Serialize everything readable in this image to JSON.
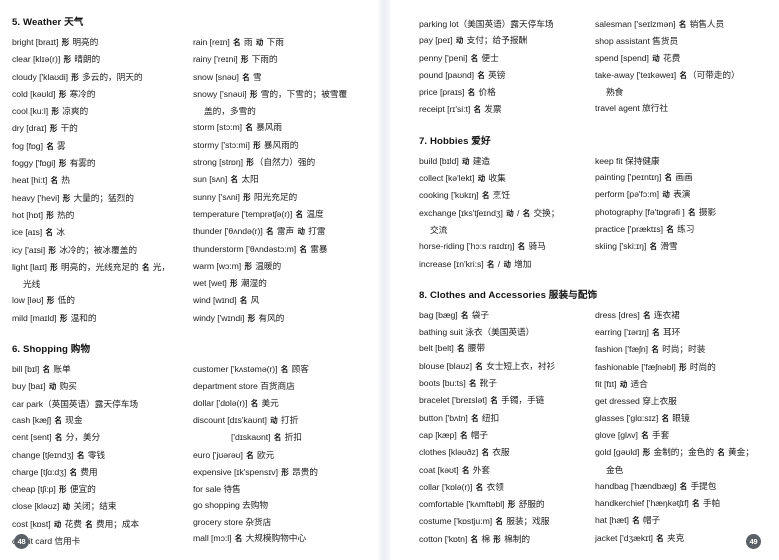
{
  "left_page": {
    "page_number": "48",
    "sections": [
      {
        "title": "5. Weather 天气",
        "column_a": [
          "bright [braɪt] 形 明亮的",
          "clear [klɪə(r)] 形 晴朗的",
          "cloudy ['klaʊdi] 形 多云的，阴天的",
          "cold [kəʊld] 形 寒冷的",
          "cool [ku:l] 形 凉爽的",
          "dry [draɪ] 形 干的",
          "fog [fɒg] 名 雾",
          "foggy ['fɒgi] 形 有雾的",
          "heat [hi:t] 名 热",
          "heavy ['hevi] 形 大量的；猛烈的",
          "hot [hɒt] 形 热的",
          "ice [aɪs] 名 冰",
          "icy ['aɪsi] 形 冰冷的；被冰覆盖的",
          "light [laɪt] 形 明亮的，光线充足的 名 光，",
          "光线",
          "low [ləʊ] 形 低的",
          "mild [maɪld] 形 温和的"
        ],
        "column_b": [
          "rain [reɪn] 名 雨 动 下雨",
          "rainy ['reɪni] 形 下雨的",
          "snow [snəʊ] 名 雪",
          "snowy ['snəʊi] 形 雪的，下雪的；被雪覆",
          "盖的，多雪的",
          "storm [stɔ:m] 名 暴风雨",
          "stormy ['stɔ:mi] 形 暴风雨的",
          "strong [strɒŋ] 形（自然力）强的",
          "sun [sʌn] 名 太阳",
          "sunny ['sʌni] 形 阳光充足的",
          "temperature ['temprətʃə(r)] 名 温度",
          "thunder ['θʌndə(r)] 名 雷声 动 打雷",
          "thunderstorm ['θʌndəstɔ:m] 名 雷暴",
          "warm [wɔ:m] 形 温暖的",
          "wet [wet] 形 潮湿的",
          "wind [wɪnd] 名 风",
          "windy ['wɪndi] 形 有风的"
        ]
      },
      {
        "title": "6. Shopping 购物",
        "column_a": [
          "bill [bɪl] 名 账单",
          "buy [baɪ] 动 购买",
          "car park（英国英语）露天停车场",
          "cash [kæʃ] 名 现金",
          "cent [sent] 名 分，美分",
          "change [tʃeɪndʒ] 名 零钱",
          "charge [tʃɑ:dʒ] 名 费用",
          "cheap [tʃi:p] 形 便宜的",
          "close [kləʊz] 动 关闭；结束",
          "cost [kɒst] 动 花费 名 费用；成本",
          "credit card 信用卡"
        ],
        "column_b": [
          "customer ['kʌstəmə(r)] 名 顾客",
          "department store 百货商店",
          "dollar ['dɒlə(r)] 名 美元",
          "discount [dɪs'kaʊnt] 动 打折",
          "['dɪskaʊnt] 名 折扣",
          "euro ['jʊərəʊ] 名 欧元",
          "expensive [ɪk'spensɪv] 形 昂贵的",
          "for sale 待售",
          "go shopping 去购物",
          "grocery store 杂货店",
          "mall [mɔ:l] 名 大规模购物中心"
        ]
      }
    ]
  },
  "right_page": {
    "page_number": "49",
    "sections": [
      {
        "title": "",
        "column_a": [
          "parking lot（美国英语）露天停车场",
          "pay [peɪ] 动 支付；给予报酬",
          "penny ['peni] 名 便士",
          "pound [paʊnd] 名 英镑",
          "price [praɪs] 名 价格",
          "receipt [rɪ'si:t] 名 发票"
        ],
        "column_b": [
          "salesman ['seɪlzmən] 名 销售人员",
          "shop assistant 售货员",
          "spend [spend] 动 花费",
          "take-away ['teɪkəweɪ] 名（可带走的）",
          "熟食",
          "travel agent 旅行社"
        ]
      },
      {
        "title": "7. Hobbies 爱好",
        "column_a": [
          "build [bɪld] 动 建造",
          "collect [kə'lekt] 动 收集",
          "cooking ['kʊkɪŋ] 名 烹饪",
          "exchange [ɪks'tʃeɪndʒ] 动 / 名 交换；",
          "交流",
          "horse-riding ['hɔ:s raɪdɪŋ] 名 骑马",
          "increase [ɪn'kri:s] 名 / 动 增加"
        ],
        "column_b": [
          "keep fit 保持健康",
          "painting ['peɪntɪŋ] 名 画画",
          "perform [pə'fɔ:m] 动 表演",
          "photography [fə'tɒgrəfi ] 名 摄影",
          "practice ['præktɪs] 名 练习",
          "skiing ['ski:ɪŋ] 名 滑雪"
        ]
      },
      {
        "title": "8. Clothes and Accessories 服装与配饰",
        "column_a": [
          "bag [bæg] 名 袋子",
          "bathing suit 泳衣（美国英语）",
          "belt [belt] 名 腰带",
          "blouse [blaʊz] 名 女士短上衣，衬衫",
          "boots [bu:ts] 名 靴子",
          "bracelet ['breɪslət] 名 手镯，手链",
          "button ['bʌtn] 名 纽扣",
          "cap [kæp] 名 帽子",
          "clothes [kləʊðz] 名 衣服",
          "coat [kəʊt] 名 外套",
          "collar ['kɒlə(r)] 名 衣领",
          "comfortable ['kʌmftəbl] 形 舒服的",
          "costume ['kɒstju:m] 名 服装；戏服",
          "cotton ['kɒtn] 名 棉 形 棉制的"
        ],
        "column_b": [
          "dress [dres] 名 连衣裙",
          "earring ['ɪərɪŋ] 名 耳环",
          "fashion ['fæʃn] 名 时尚；时装",
          "fashionable ['fæʃnəbl] 形 时尚的",
          "fit [fɪt] 动 适合",
          "get dressed 穿上衣服",
          "glasses ['glɑ:sɪz] 名 眼镜",
          "glove [glʌv] 名 手套",
          "gold [gəʊld] 形 金制的；金色的 名 黄金；",
          "金色",
          "handbag ['hændbæg] 名 手提包",
          "handkerchief ['hæŋkətʃɪf] 名 手帕",
          "hat [hæt] 名 帽子",
          "jacket ['dʒækɪt] 名 夹克"
        ]
      }
    ]
  }
}
